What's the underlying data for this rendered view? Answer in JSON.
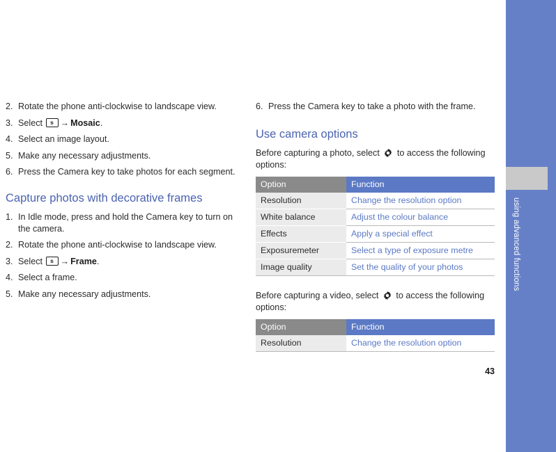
{
  "page": {
    "number": "43",
    "sidebar_label": "using advanced functions",
    "band_color": "#6680c8",
    "tab_color": "#c9c9c9",
    "heading_color": "#4a63b0",
    "table_header_option_color": "#8a8a8a",
    "table_header_function_color": "#5b79c4"
  },
  "left_column": {
    "steps_mosaic": [
      {
        "num": "2.",
        "text": "Rotate the phone anti-clockwise to landscape view."
      },
      {
        "num": "3.",
        "prefix": "Select ",
        "icon": "softkey-s-icon",
        "arrow": "→",
        "bold": "Mosaic",
        "suffix": "."
      },
      {
        "num": "4.",
        "text": "Select an image layout."
      },
      {
        "num": "5.",
        "text": "Make any necessary adjustments."
      },
      {
        "num": "6.",
        "text": "Press the Camera key to take photos for each segment."
      }
    ],
    "heading": "Capture photos with decorative frames",
    "steps_frames": [
      {
        "num": "1.",
        "text": "In Idle mode, press and hold the Camera key to turn on the camera."
      },
      {
        "num": "2.",
        "text": "Rotate the phone anti-clockwise to landscape view."
      },
      {
        "num": "3.",
        "prefix": "Select ",
        "icon": "softkey-s-icon",
        "arrow": "→",
        "bold": "Frame",
        "suffix": "."
      },
      {
        "num": "4.",
        "text": "Select a frame."
      },
      {
        "num": "5.",
        "text": "Make any necessary adjustments."
      }
    ]
  },
  "right_column": {
    "step_six": {
      "num": "6.",
      "text": "Press the Camera key to take a photo with the frame."
    },
    "heading": "Use camera options",
    "photo_intro_before": "Before capturing a photo, select ",
    "photo_intro_after": " to access the following options:",
    "photo_table": {
      "headers": [
        "Option",
        "Function"
      ],
      "rows": [
        [
          "Resolution",
          "Change the resolution option"
        ],
        [
          "White balance",
          "Adjust the colour balance"
        ],
        [
          "Effects",
          "Apply a special effect"
        ],
        [
          "Exposuremeter",
          "Select a type of exposure metre"
        ],
        [
          "Image quality",
          "Set the quality of your photos"
        ]
      ]
    },
    "video_intro_before": "Before capturing a video, select ",
    "video_intro_after": " to access the following options:",
    "video_table": {
      "headers": [
        "Option",
        "Function"
      ],
      "rows": [
        [
          "Resolution",
          "Change the resolution option"
        ]
      ]
    }
  },
  "icons": {
    "softkey_letter": "s",
    "gear": "gear-icon",
    "arrow": "→"
  }
}
